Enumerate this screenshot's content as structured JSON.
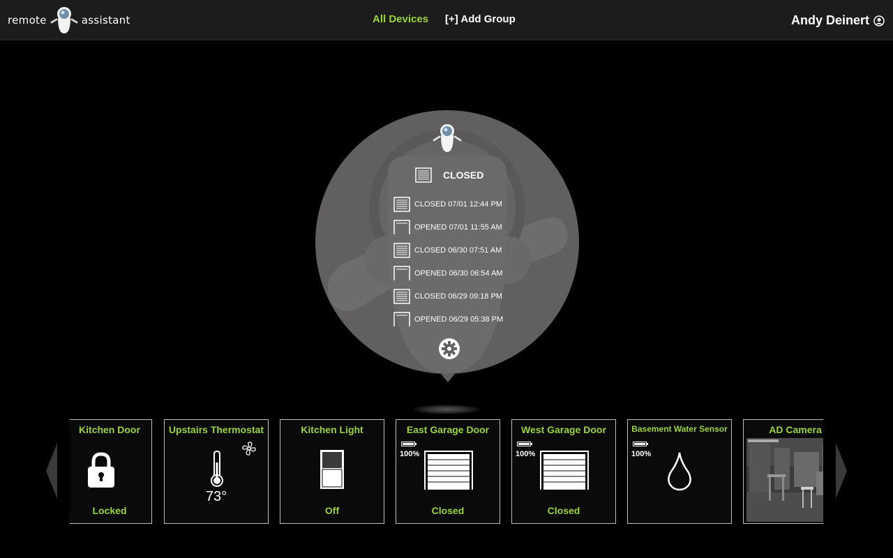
{
  "header": {
    "brand_left": "remote",
    "brand_right": "assistant",
    "nav_all_devices": "All Devices",
    "nav_add_group": "[+] Add Group",
    "user_name": "Andy Deinert"
  },
  "detail": {
    "status": "CLOSED",
    "history": [
      {
        "state": "closed",
        "text": "CLOSED 07/01 12:44 PM"
      },
      {
        "state": "opened",
        "text": "OPENED 07/01 11:55 AM"
      },
      {
        "state": "closed",
        "text": "CLOSED 06/30 07:51 AM"
      },
      {
        "state": "opened",
        "text": "OPENED 06/30 06:54 AM"
      },
      {
        "state": "closed",
        "text": "CLOSED 06/29 09:18 PM"
      },
      {
        "state": "opened",
        "text": "OPENED 06/29 05:38 PM"
      }
    ]
  },
  "devices": [
    {
      "name": "Kitchen Door",
      "status": "Locked",
      "icon": "lock-icon"
    },
    {
      "name": "Upstairs Thermostat",
      "value": "73°",
      "icon": "thermometer-icon"
    },
    {
      "name": "Kitchen Light",
      "status": "Off",
      "icon": "light-switch-icon"
    },
    {
      "name": "East Garage Door",
      "status": "Closed",
      "battery": "100%",
      "icon": "garage-door-icon"
    },
    {
      "name": "West Garage Door",
      "status": "Closed",
      "battery": "100%",
      "icon": "garage-door-icon"
    },
    {
      "name": "Basement Water Sensor",
      "battery": "100%",
      "icon": "water-drop-icon"
    },
    {
      "name": "AD Camera",
      "icon": "camera-feed"
    }
  ],
  "colors": {
    "accent": "#9bd43a",
    "header_bg": "#1c1c1c",
    "circle_bg": "#615f5f"
  }
}
